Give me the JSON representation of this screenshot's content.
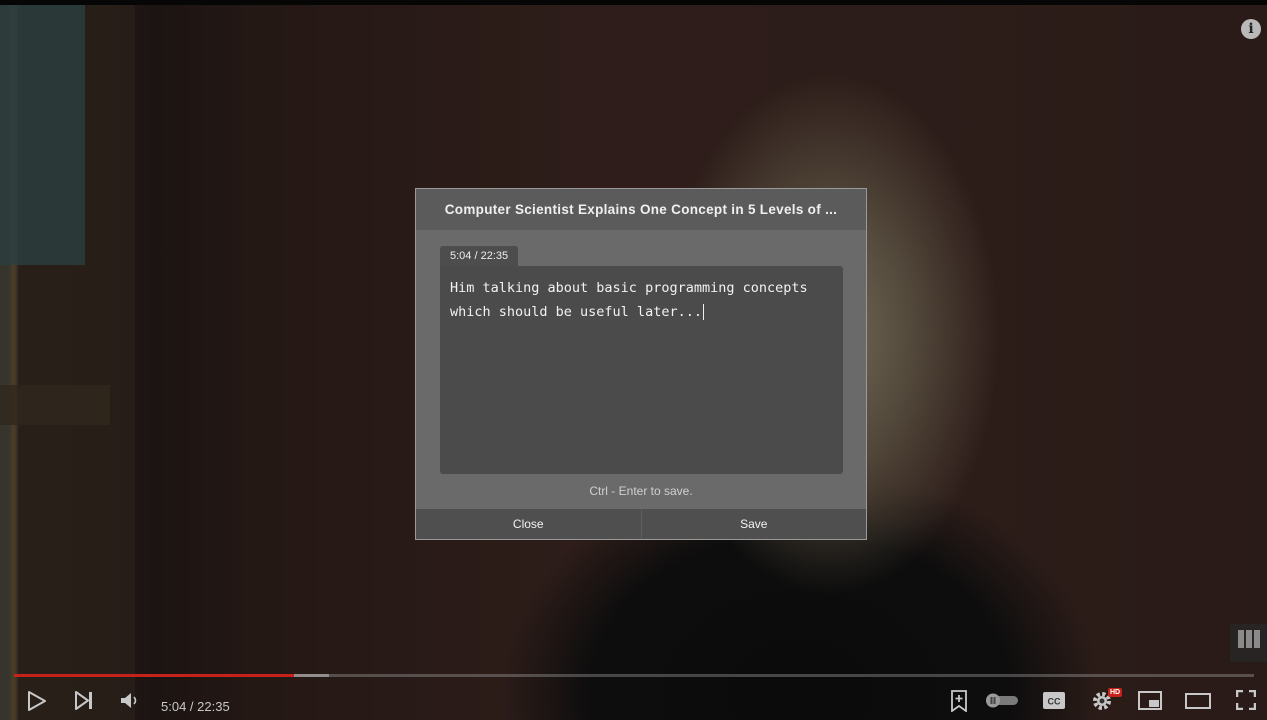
{
  "video": {
    "title": "Computer Scientist Explains One Concept in 5 Levels of ...",
    "current_time": "5:04",
    "duration": "22:35",
    "time_display": "5:04 / 22:35",
    "played_fraction": 0.226,
    "buffered_fraction": 0.254
  },
  "note_dialog": {
    "timestamp": "5:04 / 22:35",
    "note_text": "Him talking about basic programming concepts\nwhich should be useful later...",
    "hint": "Ctrl - Enter to save.",
    "close_label": "Close",
    "save_label": "Save"
  },
  "player": {
    "hd_badge": "HD",
    "info_label": "i",
    "accent_color": "#c4221b",
    "icons": [
      "play-icon",
      "next-icon",
      "volume-icon",
      "bookmark-icon",
      "autoplay-toggle-icon",
      "captions-icon",
      "settings-icon",
      "miniplayer-icon",
      "theater-icon",
      "fullscreen-icon",
      "info-icon",
      "channel-watermark-icon"
    ]
  }
}
